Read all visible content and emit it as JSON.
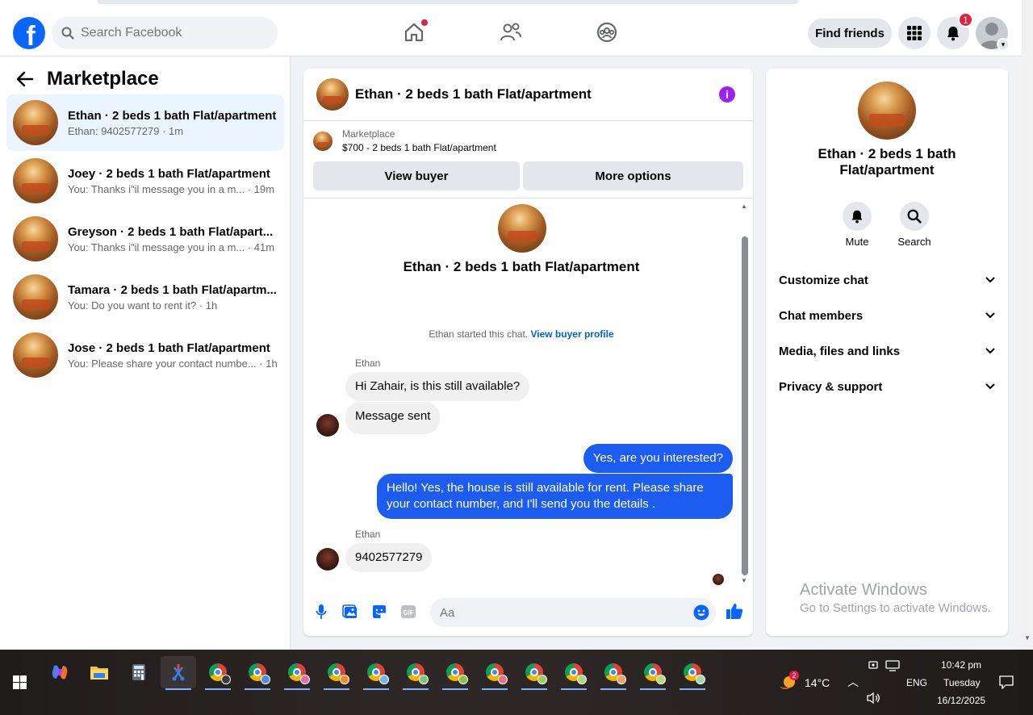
{
  "topbar": {
    "search_placeholder": "Search Facebook",
    "find_friends": "Find friends",
    "notification_count": "1"
  },
  "sidebar": {
    "title": "Marketplace",
    "conversations": [
      {
        "name": "Ethan · 2 beds 1 bath Flat/apartment",
        "sub": "Ethan: 9402577279 · 1m",
        "active": true
      },
      {
        "name": "Joey · 2 beds 1 bath Flat/apartment",
        "sub": "You: Thanks i\"il message you in a m... · 19m",
        "active": false
      },
      {
        "name": "Greyson · 2 beds 1 bath Flat/apart...",
        "sub": "You: Thanks i\"il message you in a m... · 41m",
        "active": false
      },
      {
        "name": "Tamara · 2 beds 1 bath Flat/apartm...",
        "sub": "You: Do you want to rent it? · 1h",
        "active": false
      },
      {
        "name": "Jose · 2 beds 1 bath Flat/apartment",
        "sub": "You: Please share your contact numbe... · 1h",
        "active": false
      }
    ]
  },
  "chat": {
    "title": "Ethan · 2 beds 1 bath Flat/apartment",
    "marketplace_label": "Marketplace",
    "listing": "$700 - 2 beds 1 bath Flat/apartment",
    "view_buyer": "View buyer",
    "more_options": "More options",
    "intro_title": "Ethan · 2 beds 1 bath Flat/apartment",
    "started_text": "Ethan started this chat.",
    "view_buyer_profile": "View buyer profile",
    "sender_name": "Ethan",
    "messages": [
      {
        "from": "in",
        "text": "Hi Zahair, is this still available?"
      },
      {
        "from": "in",
        "text": "Message sent"
      },
      {
        "from": "out",
        "text": "Yes, are you interested?"
      },
      {
        "from": "out",
        "text": "Hello! Yes, the house is still available for rent. Please share your contact number, and I'll send you the details ."
      },
      {
        "from": "in",
        "text": "9402577279"
      }
    ],
    "composer_placeholder": "Aa"
  },
  "details": {
    "title": "Ethan · 2 beds 1 bath Flat/apartment",
    "mute": "Mute",
    "search": "Search",
    "sections": [
      "Customize chat",
      "Chat members",
      "Media, files and links",
      "Privacy & support"
    ]
  },
  "watermark": {
    "line1": "Activate Windows",
    "line2": "Go to Settings to activate Windows."
  },
  "taskbar": {
    "weather_badge": "2",
    "temperature": "14°C",
    "language": "ENG",
    "time": "10:42 pm",
    "day": "Tuesday",
    "date": "16/12/2025"
  },
  "colors": {
    "fb_blue": "#0866ff",
    "outgoing_bubble": "#1d5cf0",
    "active_conversation": "#ebf5ff",
    "badge_red": "#e41e3f",
    "info_purple": "#a020f0"
  }
}
